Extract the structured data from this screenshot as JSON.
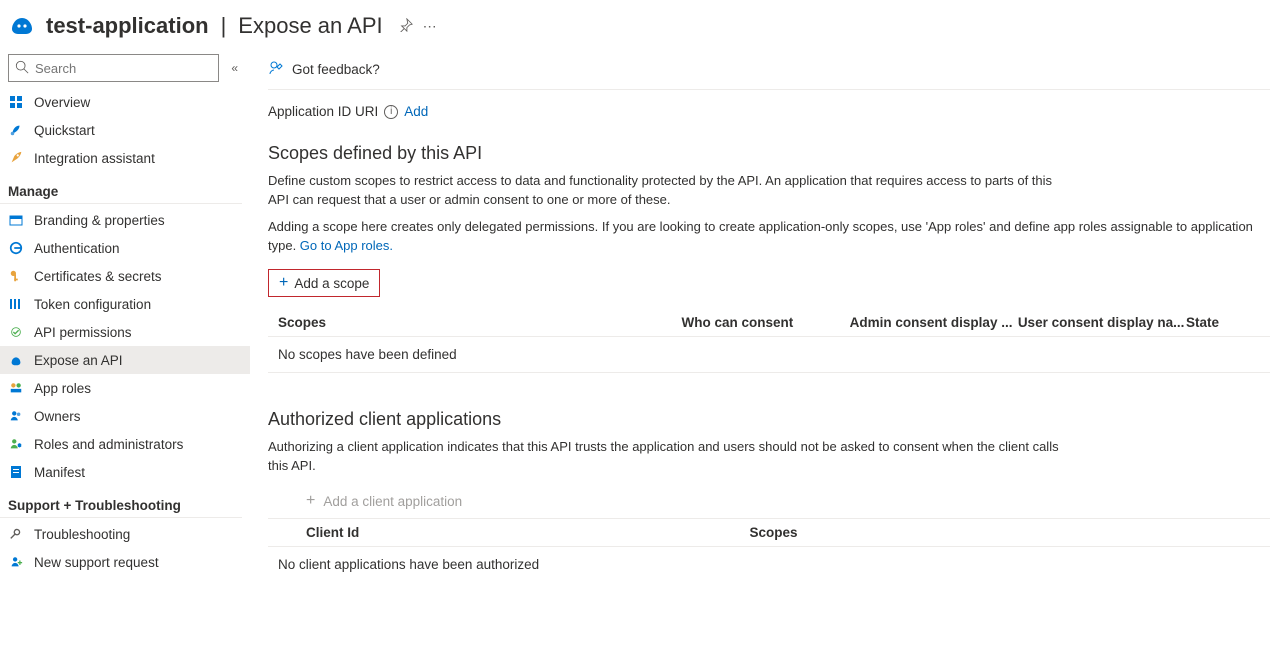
{
  "header": {
    "app_name": "test-application",
    "page_name": "Expose an API"
  },
  "search": {
    "placeholder": "Search"
  },
  "sidebar": {
    "top": [
      {
        "label": "Overview"
      },
      {
        "label": "Quickstart"
      },
      {
        "label": "Integration assistant"
      }
    ],
    "manage_header": "Manage",
    "manage": [
      {
        "label": "Branding & properties"
      },
      {
        "label": "Authentication"
      },
      {
        "label": "Certificates & secrets"
      },
      {
        "label": "Token configuration"
      },
      {
        "label": "API permissions"
      },
      {
        "label": "Expose an API"
      },
      {
        "label": "App roles"
      },
      {
        "label": "Owners"
      },
      {
        "label": "Roles and administrators"
      },
      {
        "label": "Manifest"
      }
    ],
    "support_header": "Support + Troubleshooting",
    "support": [
      {
        "label": "Troubleshooting"
      },
      {
        "label": "New support request"
      }
    ]
  },
  "cmdbar": {
    "feedback": "Got feedback?"
  },
  "uri": {
    "label": "Application ID URI",
    "add": "Add"
  },
  "scopes": {
    "title": "Scopes defined by this API",
    "desc1": "Define custom scopes to restrict access to data and functionality protected by the API. An application that requires access to parts of this API can request that a user or admin consent to one or more of these.",
    "desc2a": "Adding a scope here creates only delegated permissions. If you are looking to create application-only scopes, use 'App roles' and define app roles assignable to application type. ",
    "desc2_link": "Go to App roles.",
    "add_label": "Add a scope",
    "cols": {
      "scopes": "Scopes",
      "who": "Who can consent",
      "admin": "Admin consent display ...",
      "user": "User consent display na...",
      "state": "State"
    },
    "empty": "No scopes have been defined"
  },
  "clients": {
    "title": "Authorized client applications",
    "desc": "Authorizing a client application indicates that this API trusts the application and users should not be asked to consent when the client calls this API.",
    "add_label": "Add a client application",
    "cols": {
      "id": "Client Id",
      "scopes": "Scopes"
    },
    "empty": "No client applications have been authorized"
  }
}
